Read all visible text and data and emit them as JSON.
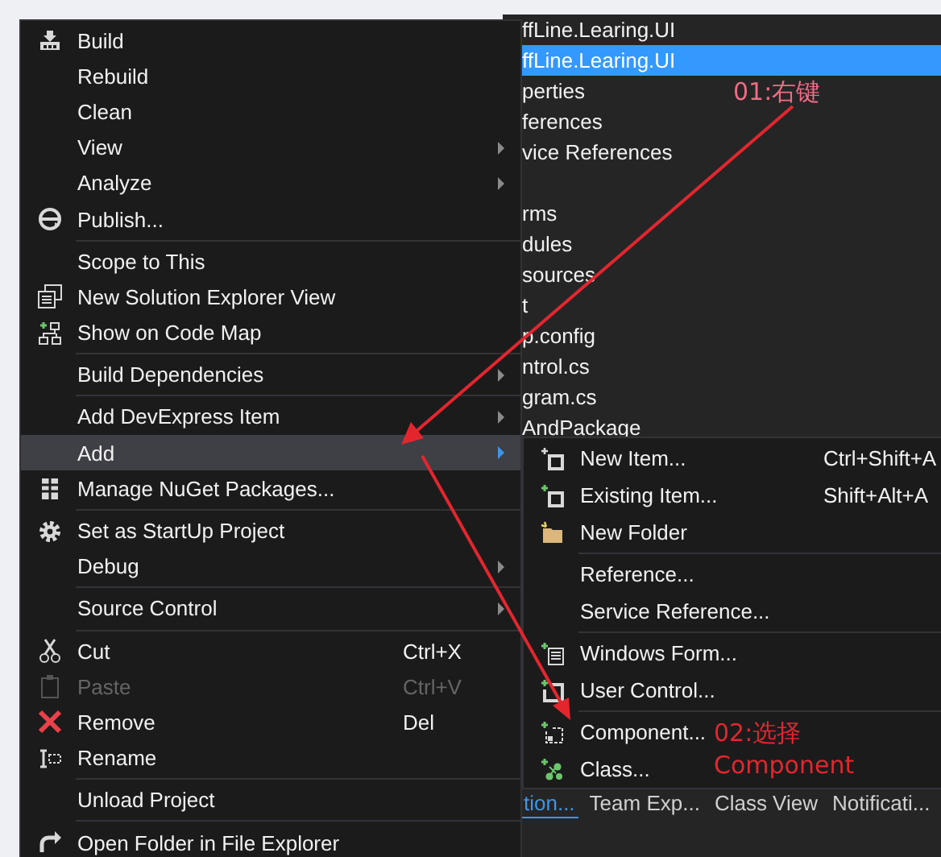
{
  "solution_explorer": {
    "rows": [
      {
        "kind": "item",
        "text": "ffLine.Learing.UI",
        "selected": false
      },
      {
        "kind": "item",
        "text": "ffLine.Learing.UI",
        "selected": true
      },
      {
        "kind": "item",
        "text": "perties",
        "selected": false
      },
      {
        "kind": "item",
        "text": "ferences",
        "selected": false
      },
      {
        "kind": "item",
        "text": "vice References",
        "selected": false
      },
      {
        "kind": "blank"
      },
      {
        "kind": "item",
        "text": "rms",
        "selected": false
      },
      {
        "kind": "item",
        "text": "dules",
        "selected": false
      },
      {
        "kind": "item",
        "text": "sources",
        "selected": false
      },
      {
        "kind": "item",
        "text": "t",
        "selected": false
      },
      {
        "kind": "item",
        "text": "p.config",
        "selected": false
      },
      {
        "kind": "item",
        "text": "ntrol.cs",
        "selected": false
      },
      {
        "kind": "item",
        "text": "gram.cs",
        "selected": false
      },
      {
        "kind": "item",
        "text": "AndPackage",
        "selected": false
      }
    ],
    "tabs": [
      {
        "label": "tion...",
        "selected": true
      },
      {
        "label": "Team Exp...",
        "selected": false
      },
      {
        "label": "Class View",
        "selected": false
      },
      {
        "label": "Notificati...",
        "selected": false
      }
    ]
  },
  "context_menu": {
    "items": [
      {
        "kind": "item",
        "label": "Build",
        "submenu": false,
        "selected": false,
        "disabled": false
      },
      {
        "kind": "item",
        "label": "Rebuild",
        "submenu": false,
        "selected": false,
        "disabled": false
      },
      {
        "kind": "item",
        "label": "Clean",
        "submenu": false,
        "selected": false,
        "disabled": false
      },
      {
        "kind": "item",
        "label": "View",
        "submenu": true,
        "selected": false,
        "disabled": false
      },
      {
        "kind": "item",
        "label": "Analyze",
        "submenu": true,
        "selected": false,
        "disabled": false
      },
      {
        "kind": "item",
        "label": "Publish...",
        "submenu": false,
        "selected": false,
        "disabled": false
      },
      {
        "kind": "separator"
      },
      {
        "kind": "item",
        "label": "Scope to This",
        "submenu": false,
        "selected": false,
        "disabled": false
      },
      {
        "kind": "item",
        "label": "New Solution Explorer View",
        "submenu": false,
        "selected": false,
        "disabled": false
      },
      {
        "kind": "item",
        "label": "Show on Code Map",
        "submenu": false,
        "selected": false,
        "disabled": false
      },
      {
        "kind": "separator"
      },
      {
        "kind": "item",
        "label": "Build Dependencies",
        "submenu": true,
        "selected": false,
        "disabled": false
      },
      {
        "kind": "separator"
      },
      {
        "kind": "item",
        "label": "Add DevExpress Item",
        "submenu": true,
        "selected": false,
        "disabled": false
      },
      {
        "kind": "item",
        "label": "Add",
        "submenu": true,
        "selected": true,
        "disabled": false
      },
      {
        "kind": "item",
        "label": "Manage NuGet Packages...",
        "submenu": false,
        "selected": false,
        "disabled": false
      },
      {
        "kind": "separator"
      },
      {
        "kind": "item",
        "label": "Set as StartUp Project",
        "submenu": false,
        "selected": false,
        "disabled": false
      },
      {
        "kind": "item",
        "label": "Debug",
        "submenu": true,
        "selected": false,
        "disabled": false
      },
      {
        "kind": "separator"
      },
      {
        "kind": "item",
        "label": "Source Control",
        "submenu": true,
        "selected": false,
        "disabled": false
      },
      {
        "kind": "separator"
      },
      {
        "kind": "item",
        "label": "Cut",
        "shortcut": "Ctrl+X",
        "submenu": false,
        "selected": false,
        "disabled": false
      },
      {
        "kind": "item",
        "label": "Paste",
        "shortcut": "Ctrl+V",
        "submenu": false,
        "selected": false,
        "disabled": true
      },
      {
        "kind": "item",
        "label": "Remove",
        "shortcut": "Del",
        "submenu": false,
        "selected": false,
        "disabled": false
      },
      {
        "kind": "item",
        "label": "Rename",
        "submenu": false,
        "selected": false,
        "disabled": false
      },
      {
        "kind": "separator"
      },
      {
        "kind": "item",
        "label": "Unload Project",
        "submenu": false,
        "selected": false,
        "disabled": false
      },
      {
        "kind": "separator"
      },
      {
        "kind": "item",
        "label": "Open Folder in File Explorer",
        "submenu": false,
        "selected": false,
        "disabled": false
      }
    ]
  },
  "add_submenu": {
    "items": [
      {
        "kind": "item",
        "label": "New Item...",
        "shortcut": "Ctrl+Shift+A"
      },
      {
        "kind": "item",
        "label": "Existing Item...",
        "shortcut": "Shift+Alt+A"
      },
      {
        "kind": "item",
        "label": "New Folder"
      },
      {
        "kind": "separator"
      },
      {
        "kind": "item",
        "label": "Reference..."
      },
      {
        "kind": "item",
        "label": "Service Reference..."
      },
      {
        "kind": "separator"
      },
      {
        "kind": "item",
        "label": "Windows Form..."
      },
      {
        "kind": "item",
        "label": "User Control..."
      },
      {
        "kind": "separator"
      },
      {
        "kind": "item",
        "label": "Component..."
      },
      {
        "kind": "item",
        "label": "Class..."
      }
    ]
  },
  "annotations": [
    {
      "lines": [
        "01:右键"
      ]
    },
    {
      "lines": [
        "02:选择",
        "Component"
      ]
    }
  ]
}
